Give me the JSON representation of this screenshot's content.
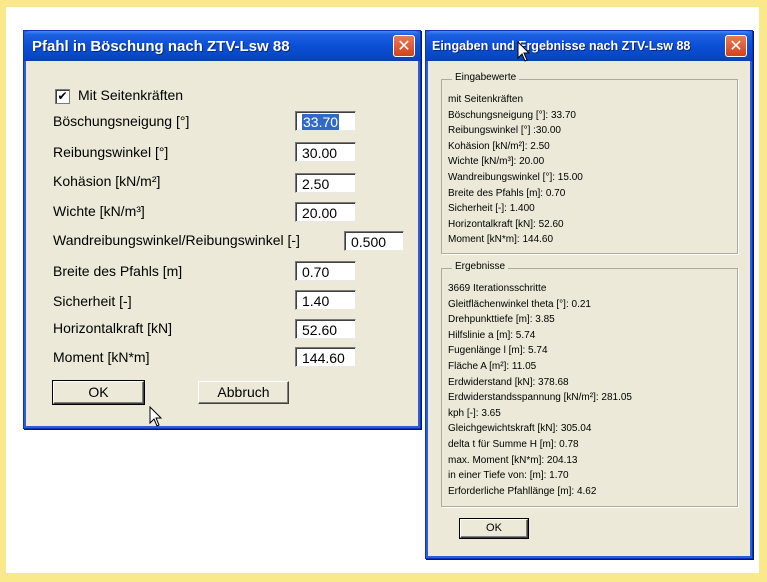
{
  "left_dialog": {
    "title": "Pfahl in Böschung nach ZTV-Lsw 88",
    "close_glyph": "✕",
    "checkbox_label": "Mit Seitenkräften",
    "checkbox_checked": true,
    "fields": {
      "boeschungsneigung": {
        "label": "Böschungsneigung [°]",
        "value": "33.70"
      },
      "reibungswinkel": {
        "label": "Reibungswinkel [°]",
        "value": "30.00"
      },
      "kohaesion": {
        "label": "Kohäsion [kN/m²]",
        "value": "2.50"
      },
      "wichte": {
        "label": "Wichte [kN/m³]",
        "value": "20.00"
      },
      "wandreibung": {
        "label": "Wandreibungswinkel/Reibungswinkel [-]",
        "value": "0.500"
      },
      "breite": {
        "label": "Breite des Pfahls [m]",
        "value": "0.70"
      },
      "sicherheit": {
        "label": "Sicherheit [-]",
        "value": "1.40"
      },
      "horizontalkraft": {
        "label": "Horizontalkraft [kN]",
        "value": "52.60"
      },
      "moment": {
        "label": "Moment [kN*m]",
        "value": "144.60"
      }
    },
    "ok_label": "OK",
    "cancel_label": "Abbruch"
  },
  "right_dialog": {
    "title": "Eingaben und Ergebnisse nach ZTV-Lsw 88",
    "close_glyph": "✕",
    "inputs_group": {
      "title": "Eingabewerte",
      "lines": [
        "mit Seitenkräften",
        "Böschungsneigung [°]: 33.70",
        "Reibungswinkel [°] :30.00",
        "Kohäsion [kN/m²]: 2.50",
        "Wichte [kN/m³]: 20.00",
        "Wandreibungswinkel [°]: 15.00",
        "Breite des Pfahls [m]: 0.70",
        "Sicherheit [-]: 1.400",
        "Horizontalkraft [kN]: 52.60",
        "Moment [kN*m]: 144.60"
      ]
    },
    "results_group": {
      "title": "Ergebnisse",
      "lines": [
        "3669 Iterationsschritte",
        "Gleitflächenwinkel theta [°]: 0.21",
        "Drehpunkttiefe [m]: 3.85",
        "Hilfslinie a [m]: 5.74",
        "Fugenlänge l [m]: 5.74",
        "Fläche A [m²]: 11.05",
        "Erdwiderstand [kN]: 378.68",
        "Erdwiderstandsspannung [kN/m²]: 281.05",
        "kph [-]: 3.65",
        "Gleichgewichtskraft [kN]: 305.04",
        "delta t für Summe H [m]: 0.78",
        "max. Moment [kN*m]: 204.13",
        "in einer Tiefe von: [m]: 1.70",
        "Erforderliche Pfahllänge [m]: 4.62"
      ]
    },
    "ok_label": "OK"
  },
  "colors": {
    "outer_background": "#f9e98a",
    "titlebar": "#0a4fd6",
    "dialog_face": "#ece9d8",
    "selection": "#316ac5"
  }
}
